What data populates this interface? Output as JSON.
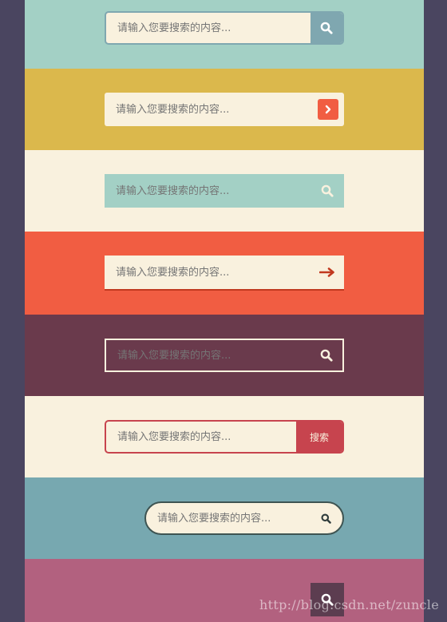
{
  "colors": {
    "page_background": "#4a4560",
    "cream": "#f9f1de",
    "mint": "#a3d0c5",
    "mustard": "#dbb84c",
    "coral": "#f15d42",
    "plum": "#6a3a4c",
    "teal": "#77a8b0",
    "rose": "#b2617f",
    "crimson": "#c7444e"
  },
  "search_bars": [
    {
      "placeholder": "请输入您要搜索的内容...",
      "button_icon": "search-icon",
      "button_color": "#7fa7b0"
    },
    {
      "placeholder": "请输入您要搜索的内容...",
      "button_icon": "chevron-right-icon",
      "button_color": "#f15d42"
    },
    {
      "placeholder": "请输入您要搜索的内容...",
      "button_icon": "search-icon"
    },
    {
      "placeholder": "请输入您要搜索的内容...",
      "button_icon": "arrow-right-icon"
    },
    {
      "placeholder": "请输入您要搜索的内容...",
      "button_icon": "search-icon"
    },
    {
      "placeholder": "请输入您要搜索的内容...",
      "button_label": "搜索",
      "button_color": "#c7444e"
    },
    {
      "placeholder": "请输入您要搜索的内容...",
      "button_icon": "search-icon"
    },
    {
      "button_icon": "search-icon",
      "button_color": "#5c3d50"
    }
  ],
  "watermark": "http://blog.csdn.net/zuncle"
}
